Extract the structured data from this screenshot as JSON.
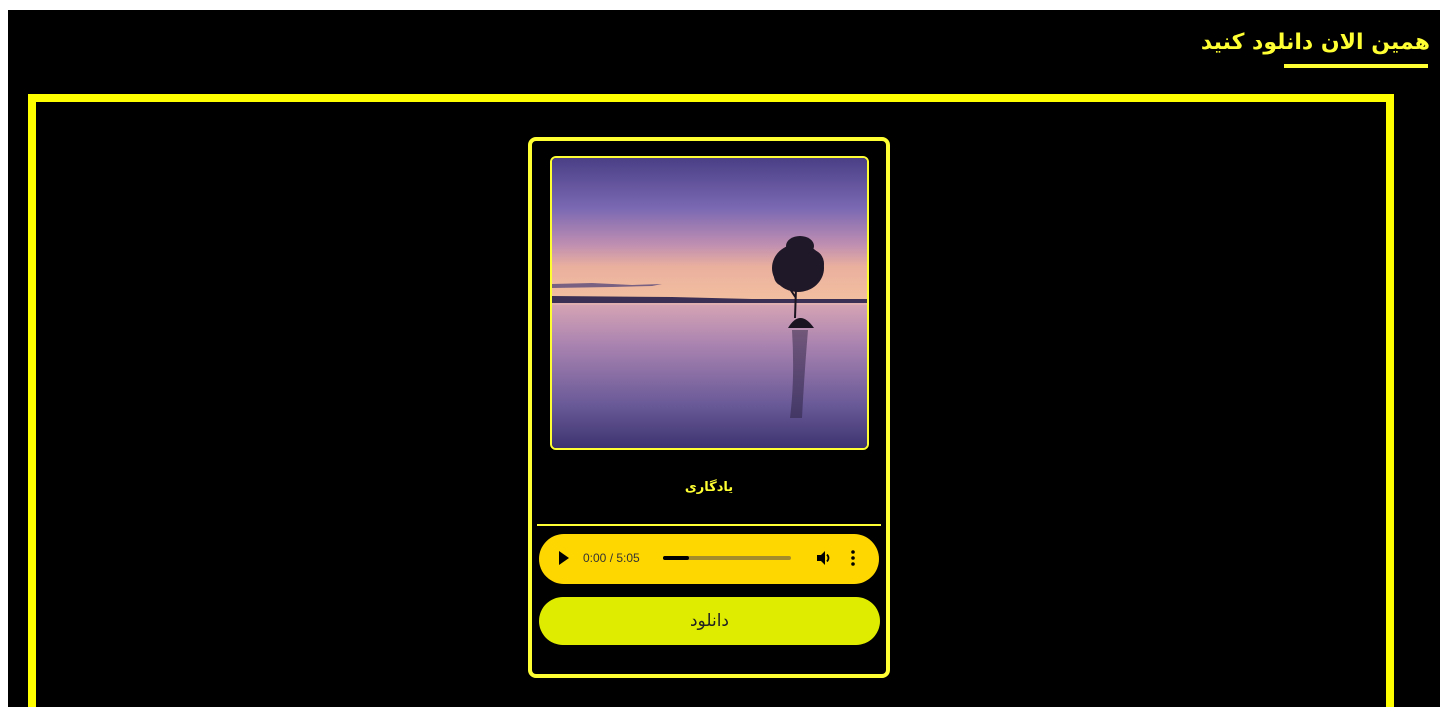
{
  "header": {
    "title": "همین الان دانلود کنید"
  },
  "card": {
    "cover_alt": "Sunset over calm lake with lone tree",
    "song_title": "یادگاری",
    "player": {
      "current_time": "0:00",
      "duration": "5:05",
      "time_display": "0:00 / 5:05",
      "progress_fraction": 0.2,
      "play_icon": "play-icon",
      "volume_icon": "volume-icon",
      "more_icon": "more-vertical-icon"
    },
    "download_label": "دانلود"
  },
  "colors": {
    "background": "#000000",
    "accent": "#ffff33",
    "player_bg": "#ffd700",
    "download_bg": "#dfec00"
  }
}
